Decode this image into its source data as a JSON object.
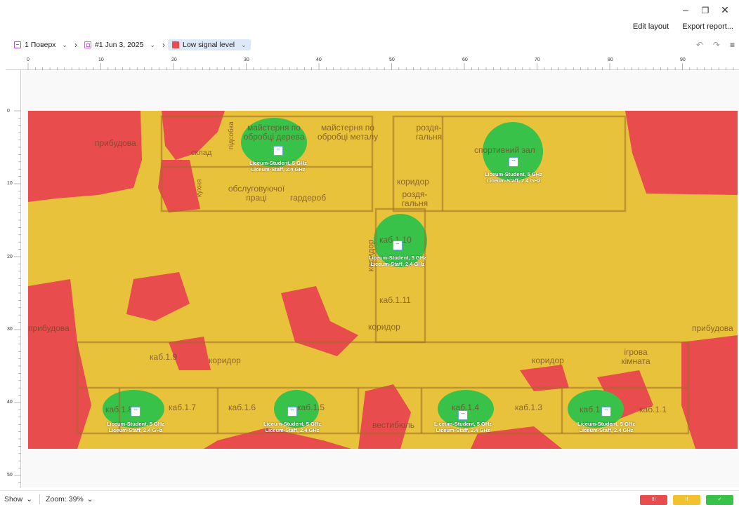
{
  "window": {
    "minimize_glyph": "–",
    "maximize_glyph": "❐",
    "close_glyph": "✕"
  },
  "top_actions": {
    "edit_layout": "Edit layout",
    "export_report": "Export report..."
  },
  "breadcrumb": {
    "floor": "1 Поверх",
    "survey": "#1 Jun 3, 2025",
    "visualization": "Low signal level",
    "chevron": "⌄",
    "separator": "›"
  },
  "toolbar": {
    "undo_glyph": "↶",
    "redo_glyph": "↷",
    "settings_glyph": "≡"
  },
  "ruler": {
    "x_labels": [
      "0",
      "10",
      "20",
      "30",
      "40",
      "50",
      "60",
      "70",
      "80",
      "90"
    ],
    "y_labels": [
      "0",
      "10",
      "20",
      "30",
      "40",
      "50"
    ]
  },
  "rooms": [
    {
      "text": "прибудова"
    },
    {
      "text": "склад"
    },
    {
      "text": "підсобка"
    },
    {
      "text": "майстерня по обробці дерева"
    },
    {
      "text": "майстерня по обробці металу"
    },
    {
      "text": "роздя-гальня"
    },
    {
      "text": "спортивний зал"
    },
    {
      "text": "кухня"
    },
    {
      "text": "обслуговуючої праці"
    },
    {
      "text": "гардероб"
    },
    {
      "text": "коридор"
    },
    {
      "text": "роздя-гальня"
    },
    {
      "text": "каб.1.10"
    },
    {
      "text": "каб.1.11"
    },
    {
      "text": "коридор"
    },
    {
      "text": "прибудова"
    },
    {
      "text": "каб.1.9"
    },
    {
      "text": "коридор"
    },
    {
      "text": "коридор"
    },
    {
      "text": "ігрова кімната"
    },
    {
      "text": "прибудова"
    },
    {
      "text": "каб.1.8"
    },
    {
      "text": "каб.1.7"
    },
    {
      "text": "каб.1.6"
    },
    {
      "text": "каб.1.5"
    },
    {
      "text": "вестибюль"
    },
    {
      "text": "каб.1.4"
    },
    {
      "text": "каб.1.3"
    },
    {
      "text": "каб.1.2"
    },
    {
      "text": "каб.1.1"
    },
    {
      "text": "коридор"
    }
  ],
  "access_points": [
    {
      "line1": "Liceum-Student, 5 GHz",
      "line2": "Liceum-Staff, 2.4 GHz"
    },
    {
      "line1": "Liceum-Student, 5 GHz",
      "line2": "Liceum-Staff, 2.4 GHz"
    },
    {
      "line1": "Liceum-Student, 5 GHz",
      "line2": "Liceum-Staff, 2.4 GHz"
    },
    {
      "line1": "Liceum-Student, 5 GHz",
      "line2": "Liceum-Staff, 2.4 GHz"
    },
    {
      "line1": "Liceum-Student, 5 GHz",
      "line2": "Liceum-Staff, 2.4 GHz"
    },
    {
      "line1": "Liceum-Student, 5 GHz",
      "line2": "Liceum-Staff, 2.4 GHz"
    },
    {
      "line1": "Liceum-Student, 5 GHz",
      "line2": "Liceum-Staff, 2.4 GHz"
    }
  ],
  "ap_icon": "wifi-icon",
  "colors": {
    "low_signal": "#e84c4c",
    "medium_signal": "#f2c12e",
    "good_signal": "#39c24a",
    "breadcrumb_active": "#dde9f7"
  },
  "status_bar": {
    "show": "Show",
    "zoom": "Zoom: 39%"
  },
  "legend": {
    "bad": "!!!",
    "medium": "!!",
    "good": "✓"
  }
}
